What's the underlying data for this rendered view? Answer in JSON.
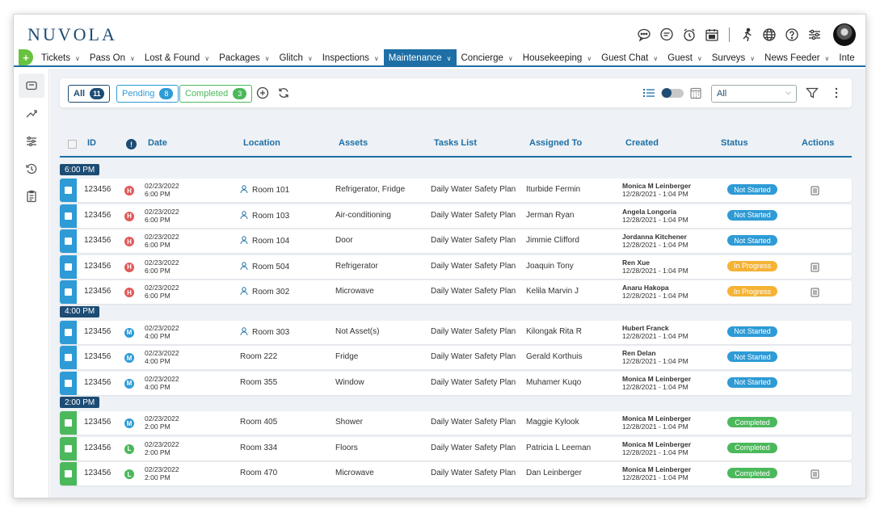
{
  "app": {
    "logo": "NUVOLA"
  },
  "header_icons": [
    "chat-bubble-icon",
    "message-icon",
    "alarm-clock-icon",
    "calendar-icon",
    "run-icon",
    "globe-icon",
    "help-icon",
    "settings-sliders-icon"
  ],
  "nav": {
    "items": [
      {
        "label": "Tickets",
        "active": false
      },
      {
        "label": "Pass On",
        "active": false
      },
      {
        "label": "Lost & Found",
        "active": false
      },
      {
        "label": "Packages",
        "active": false
      },
      {
        "label": "Glitch",
        "active": false
      },
      {
        "label": "Inspections",
        "active": false
      },
      {
        "label": "Maintenance",
        "active": true
      },
      {
        "label": "Concierge",
        "active": false
      },
      {
        "label": "Housekeeping",
        "active": false
      },
      {
        "label": "Guest Chat",
        "active": false
      },
      {
        "label": "Guest",
        "active": false
      },
      {
        "label": "Surveys",
        "active": false
      },
      {
        "label": "News Feeder",
        "active": false
      },
      {
        "label": "Inte",
        "active": false
      }
    ]
  },
  "filters": {
    "all": {
      "label": "All",
      "count": "11"
    },
    "pending": {
      "label": "Pending",
      "count": "8"
    },
    "completed": {
      "label": "Completed",
      "count": "3"
    },
    "select_value": "All"
  },
  "table": {
    "columns": {
      "id": "ID",
      "info": "!",
      "date": "Date",
      "location": "Location",
      "assets": "Assets",
      "tasks": "Tasks List",
      "assigned": "Assigned To",
      "created": "Created",
      "status": "Status",
      "actions": "Actions"
    },
    "groups": [
      {
        "label": "6:00 PM",
        "color": "#2e9bd6",
        "rows": [
          {
            "id": "123456",
            "priority": "H",
            "date": "02/23/2022",
            "time": "6:00 PM",
            "location": "Room 101",
            "guest": true,
            "assets": "Refrigerator, Fridge",
            "tasks": "Daily Water Safety Plan",
            "assigned": "Iturbide Fermin",
            "created_by": "Monica M Leinberger",
            "created_at": "12/28/2021 - 1:04 PM",
            "status": "Not Started",
            "action": true
          },
          {
            "id": "123456",
            "priority": "H",
            "date": "02/23/2022",
            "time": "6:00 PM",
            "location": "Room 103",
            "guest": true,
            "assets": "Air-conditioning",
            "tasks": "Daily Water Safety Plan",
            "assigned": "Jerman Ryan",
            "created_by": "Angela Longoria",
            "created_at": "12/28/2021 - 1:04 PM",
            "status": "Not Started",
            "action": false
          },
          {
            "id": "123456",
            "priority": "H",
            "date": "02/23/2022",
            "time": "6:00 PM",
            "location": "Room 104",
            "guest": true,
            "assets": "Door",
            "tasks": "Daily Water Safety Plan",
            "assigned": "Jimmie Clifford",
            "created_by": "Jordanna Kitchener",
            "created_at": "12/28/2021 - 1:04 PM",
            "status": "Not Started",
            "action": false
          },
          {
            "id": "123456",
            "priority": "H",
            "date": "02/23/2022",
            "time": "6:00 PM",
            "location": "Room 504",
            "guest": true,
            "assets": "Refrigerator",
            "tasks": "Daily Water Safety Plan",
            "assigned": "Joaquin Tony",
            "created_by": "Ren Xue",
            "created_at": "12/28/2021 - 1:04 PM",
            "status": "In Progress",
            "action": true
          },
          {
            "id": "123456",
            "priority": "H",
            "date": "02/23/2022",
            "time": "6:00 PM",
            "location": "Room 302",
            "guest": true,
            "assets": "Microwave",
            "tasks": "Daily Water Safety Plan",
            "assigned": "Kelila Marvin J",
            "created_by": "Anaru Hakopa",
            "created_at": "12/28/2021 - 1:04 PM",
            "status": "In Progress",
            "action": true
          }
        ]
      },
      {
        "label": "4:00 PM",
        "color": "#2e9bd6",
        "rows": [
          {
            "id": "123456",
            "priority": "M",
            "date": "02/23/2022",
            "time": "4:00 PM",
            "location": "Room 303",
            "guest": true,
            "assets": "Not Asset(s)",
            "tasks": "Daily Water Safety Plan",
            "assigned": "Kilongak Rita R",
            "created_by": "Hubert Franck",
            "created_at": "12/28/2021 - 1:04 PM",
            "status": "Not Started",
            "action": false
          },
          {
            "id": "123456",
            "priority": "M",
            "date": "02/23/2022",
            "time": "4:00 PM",
            "location": "Room 222",
            "guest": false,
            "assets": "Fridge",
            "tasks": "Daily Water Safety Plan",
            "assigned": "Gerald Korthuis",
            "created_by": "Ren Delan",
            "created_at": "12/28/2021 - 1:04 PM",
            "status": "Not Started",
            "action": false
          },
          {
            "id": "123456",
            "priority": "M",
            "date": "02/23/2022",
            "time": "4:00 PM",
            "location": "Room 355",
            "guest": false,
            "assets": "Window",
            "tasks": "Daily Water Safety Plan",
            "assigned": "Muhamer Kuqo",
            "created_by": "Monica M Leinberger",
            "created_at": "12/28/2021 - 1:04 PM",
            "status": "Not Started",
            "action": false
          }
        ]
      },
      {
        "label": "2:00 PM",
        "color": "#4cb85c",
        "rows": [
          {
            "id": "123456",
            "priority": "M",
            "date": "02/23/2022",
            "time": "2:00 PM",
            "location": "Room 405",
            "guest": false,
            "assets": "Shower",
            "tasks": "Daily Water Safety Plan",
            "assigned": "Maggie Kylook",
            "created_by": "Monica M Leinberger",
            "created_at": "12/28/2021 - 1:04 PM",
            "status": "Completed",
            "action": false
          },
          {
            "id": "123456",
            "priority": "L",
            "date": "02/23/2022",
            "time": "2:00 PM",
            "location": "Room 334",
            "guest": false,
            "assets": "Floors",
            "tasks": "Daily Water Safety Plan",
            "assigned": "Patricia L Leeman",
            "created_by": "Monica M Leinberger",
            "created_at": "12/28/2021 - 1:04 PM",
            "status": "Completed",
            "action": false
          },
          {
            "id": "123456",
            "priority": "L",
            "date": "02/23/2022",
            "time": "2:00 PM",
            "location": "Room 470",
            "guest": false,
            "assets": "Microwave",
            "tasks": "Daily Water Safety Plan",
            "assigned": "Dan Leinberger",
            "created_by": "Monica M Leinberger",
            "created_at": "12/28/2021 - 1:04 PM",
            "status": "Completed",
            "action": true
          }
        ]
      }
    ]
  },
  "status_colors": {
    "Not Started": "#2e9bd6",
    "In Progress": "#f5b335",
    "Completed": "#4cb85c"
  }
}
